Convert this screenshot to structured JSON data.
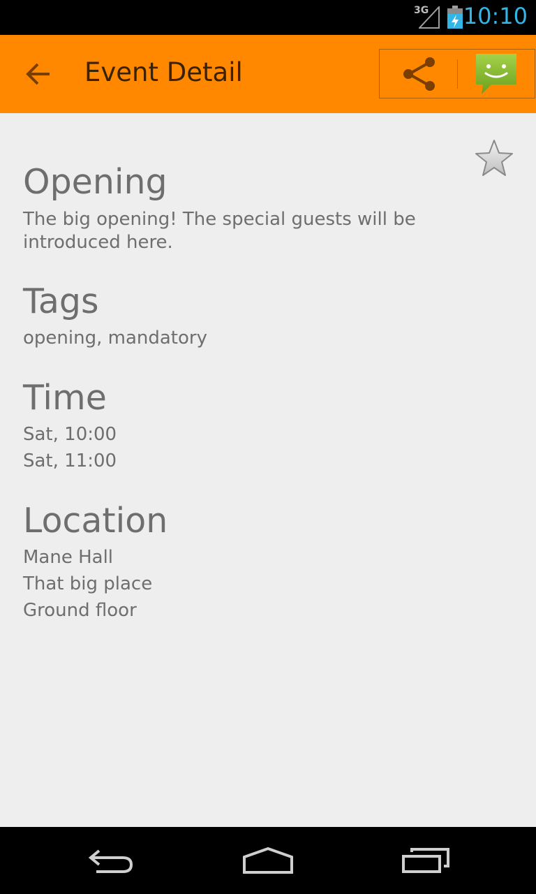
{
  "status_bar": {
    "network": "3G",
    "time": "10:10",
    "clock_color": "#33b5e5"
  },
  "action_bar": {
    "title": "Event Detail",
    "background_color": "#ff8800",
    "back_icon": "arrow-left-icon",
    "share_icon": "share-icon",
    "messaging_icon": "sms-smiley-icon"
  },
  "event": {
    "favorite_icon": "star-outline-icon",
    "title": "Opening",
    "description": "The big opening! The special guests will be introduced here.",
    "tags_heading": "Tags",
    "tags": "opening, mandatory",
    "time_heading": "Time",
    "time_start": "Sat, 10:00",
    "time_end": "Sat, 11:00",
    "location_heading": "Location",
    "location_lines": [
      "Mane Hall",
      "That big place",
      "Ground floor"
    ]
  },
  "nav_bar": {
    "back_icon": "back-icon",
    "home_icon": "home-icon",
    "recents_icon": "recents-icon"
  }
}
